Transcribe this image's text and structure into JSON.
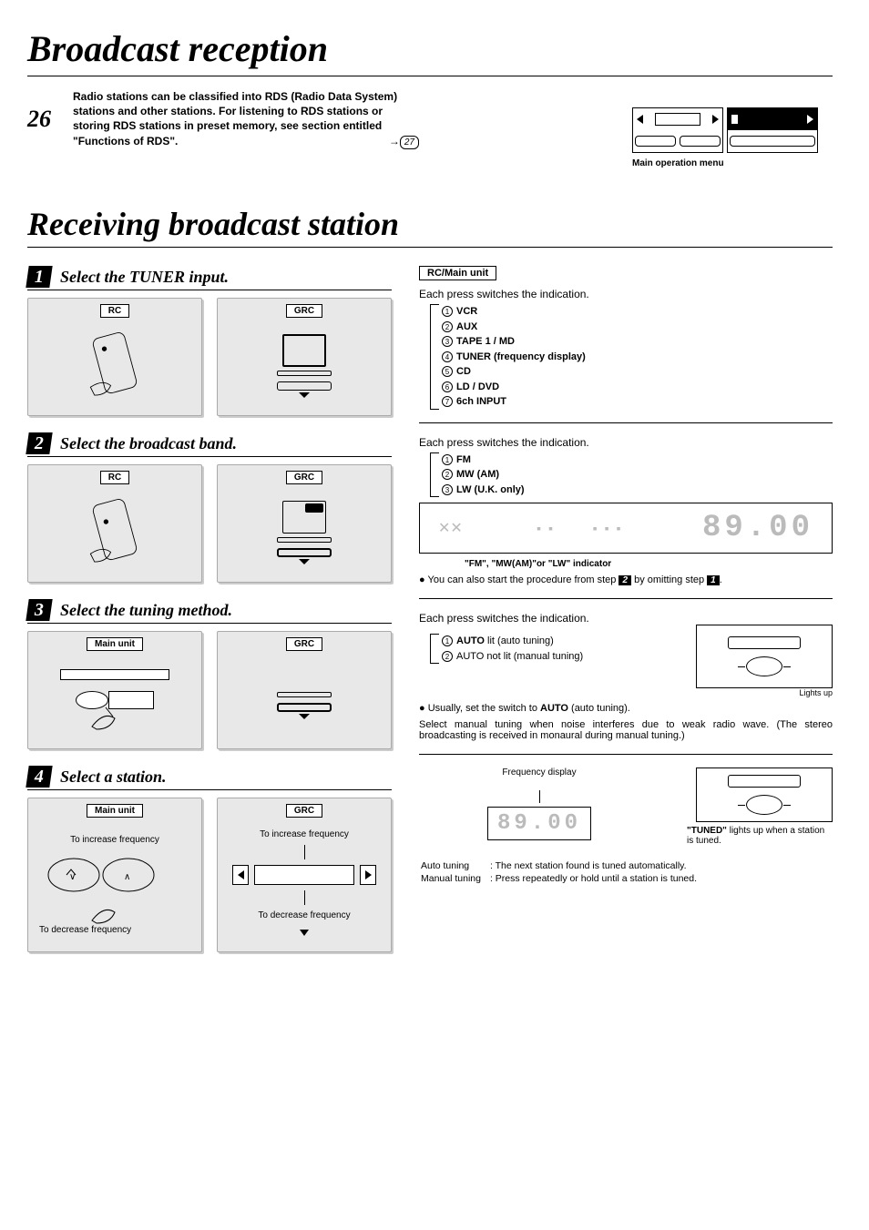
{
  "page_number": "26",
  "main_title": "Broadcast reception",
  "intro_text": "Radio stations can be classified into RDS (Radio Data System) stations and other stations. For listening to RDS stations or storing RDS stations in preset memory, see section entitled \"Functions of RDS\".",
  "intro_ref": "27",
  "menu_caption": "Main operation menu",
  "sub_title": "Receiving broadcast station",
  "steps": [
    {
      "num": "1",
      "title": "Select the TUNER input."
    },
    {
      "num": "2",
      "title": "Select the broadcast band."
    },
    {
      "num": "3",
      "title": "Select the tuning method."
    },
    {
      "num": "4",
      "title": "Select a station."
    }
  ],
  "labels": {
    "rc": "RC",
    "grc": "GRC",
    "main_unit": "Main unit",
    "rc_main_unit": "RC/Main unit"
  },
  "step4_captions": {
    "inc_left": "To increase frequency",
    "inc_right": "To increase frequency",
    "dec_left": "To decrease frequency",
    "dec_right": "To decrease frequency"
  },
  "right": {
    "press_switch": "Each press switches the indication.",
    "inputs": [
      "VCR",
      "AUX",
      "TAPE 1 / MD",
      "TUNER (frequency display)",
      "CD",
      "LD /  DVD",
      "6ch INPUT"
    ],
    "bands": [
      "FM",
      "MW (AM)",
      "LW (U.K. only)"
    ],
    "lcd_freq": "89.00",
    "indicator_note": "\"FM\", \"MW(AM)\"or \"LW\" indicator",
    "omit_note_pre": "You can also start the procedure from step ",
    "omit_note_mid": " by omitting step ",
    "tuning_modes": [
      "AUTO lit (auto tuning)",
      "AUTO not lit (manual tuning)"
    ],
    "lights_up": "Lights up",
    "auto_note": "Usually, set the switch to AUTO (auto tuning).",
    "auto_note_pre": "Usually, set the switch to ",
    "auto_note_bold": "AUTO",
    "auto_note_post": " (auto tuning).",
    "manual_note": "Select manual tuning when noise interferes due to weak radio wave. (The stereo broadcasting is received in monaural during manual tuning.)",
    "freq_display_label": "Frequency display",
    "tuned_note_bold": "\"TUNED\"",
    "tuned_note_rest": " lights up when a station is tuned.",
    "table": {
      "auto_label": "Auto tuning",
      "auto_desc": ": The next station found is tuned automatically.",
      "manual_label": "Manual tuning",
      "manual_desc": ": Press repeatedly or hold until a station is tuned."
    }
  }
}
